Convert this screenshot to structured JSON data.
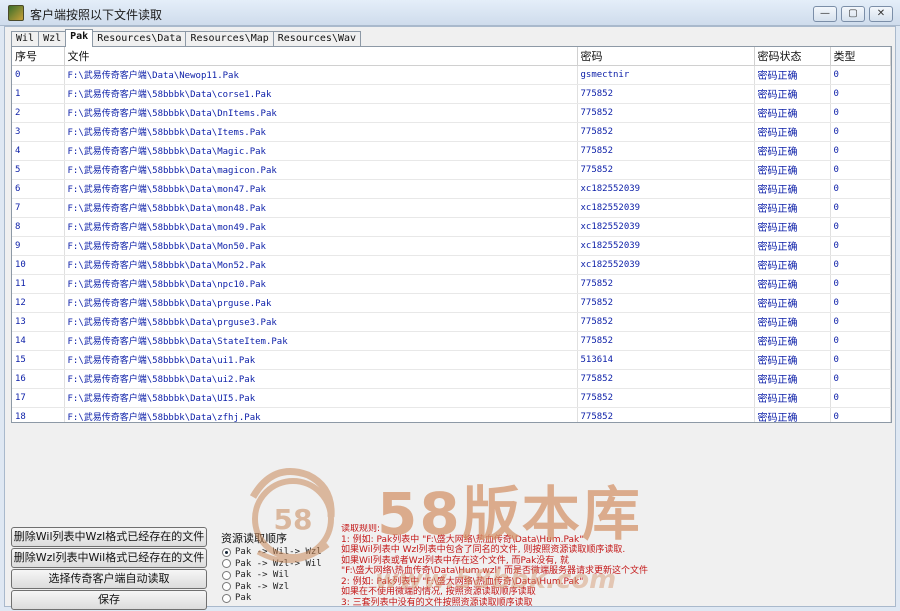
{
  "window": {
    "title": "客户端按照以下文件读取",
    "min": "—",
    "max": "▢",
    "close": "✕"
  },
  "tabs": [
    {
      "label": "Wil",
      "active": false
    },
    {
      "label": "Wzl",
      "active": false
    },
    {
      "label": "Pak",
      "active": true
    },
    {
      "label": "Resources\\Data",
      "active": false
    },
    {
      "label": "Resources\\Map",
      "active": false
    },
    {
      "label": "Resources\\Wav",
      "active": false
    }
  ],
  "table": {
    "headers": [
      "序号",
      "文件",
      "密码",
      "密码状态",
      "类型"
    ],
    "rows": [
      [
        "0",
        "F:\\武易传奇客户端\\Data\\Newop11.Pak",
        "gsmectnir",
        "密码正确",
        "0"
      ],
      [
        "1",
        "F:\\武易传奇客户端\\58bbbk\\Data\\corse1.Pak",
        "775852",
        "密码正确",
        "0"
      ],
      [
        "2",
        "F:\\武易传奇客户端\\58bbbk\\Data\\DnItems.Pak",
        "775852",
        "密码正确",
        "0"
      ],
      [
        "3",
        "F:\\武易传奇客户端\\58bbbk\\Data\\Items.Pak",
        "775852",
        "密码正确",
        "0"
      ],
      [
        "4",
        "F:\\武易传奇客户端\\58bbbk\\Data\\Magic.Pak",
        "775852",
        "密码正确",
        "0"
      ],
      [
        "5",
        "F:\\武易传奇客户端\\58bbbk\\Data\\magicon.Pak",
        "775852",
        "密码正确",
        "0"
      ],
      [
        "6",
        "F:\\武易传奇客户端\\58bbbk\\Data\\mon47.Pak",
        "xc182552039",
        "密码正确",
        "0"
      ],
      [
        "7",
        "F:\\武易传奇客户端\\58bbbk\\Data\\mon48.Pak",
        "xc182552039",
        "密码正确",
        "0"
      ],
      [
        "8",
        "F:\\武易传奇客户端\\58bbbk\\Data\\mon49.Pak",
        "xc182552039",
        "密码正确",
        "0"
      ],
      [
        "9",
        "F:\\武易传奇客户端\\58bbbk\\Data\\Mon50.Pak",
        "xc182552039",
        "密码正确",
        "0"
      ],
      [
        "10",
        "F:\\武易传奇客户端\\58bbbk\\Data\\Mon52.Pak",
        "xc182552039",
        "密码正确",
        "0"
      ],
      [
        "11",
        "F:\\武易传奇客户端\\58bbbk\\Data\\npc10.Pak",
        "775852",
        "密码正确",
        "0"
      ],
      [
        "12",
        "F:\\武易传奇客户端\\58bbbk\\Data\\prguse.Pak",
        "775852",
        "密码正确",
        "0"
      ],
      [
        "13",
        "F:\\武易传奇客户端\\58bbbk\\Data\\prguse3.Pak",
        "775852",
        "密码正确",
        "0"
      ],
      [
        "14",
        "F:\\武易传奇客户端\\58bbbk\\Data\\StateItem.Pak",
        "775852",
        "密码正确",
        "0"
      ],
      [
        "15",
        "F:\\武易传奇客户端\\58bbbk\\Data\\ui1.Pak",
        "513614",
        "密码正确",
        "0"
      ],
      [
        "16",
        "F:\\武易传奇客户端\\58bbbk\\Data\\ui2.Pak",
        "775852",
        "密码正确",
        "0"
      ],
      [
        "17",
        "F:\\武易传奇客户端\\58bbbk\\Data\\UI5.Pak",
        "775852",
        "密码正确",
        "0"
      ],
      [
        "18",
        "F:\\武易传奇客户端\\58bbbk\\Data\\zfhj.Pak",
        "775852",
        "密码正确",
        "0"
      ]
    ]
  },
  "buttons": {
    "delete_wil": "删除Wil列表中Wzl格式已经存在的文件",
    "delete_wzl": "删除Wzl列表中Wil格式已经存在的文件",
    "auto_read": "选择传奇客户端自动读取",
    "save": "保存"
  },
  "read_order": {
    "title": "资源读取顺序",
    "options": [
      {
        "label": "Pak -> Wil-> Wzl",
        "selected": true
      },
      {
        "label": "Pak -> Wzl-> Wil",
        "selected": false
      },
      {
        "label": "Pak -> Wil",
        "selected": false
      },
      {
        "label": "Pak -> Wzl",
        "selected": false
      },
      {
        "label": "Pak",
        "selected": false
      }
    ]
  },
  "rules": {
    "lines": [
      "读取规则:",
      "1: 例如: Pak列表中 \"F:\\盛大网络\\热血传奇\\Data\\Hum.Pak\"",
      "   如果Wil列表中 Wzl列表中包含了同名的文件, 则按照资源读取顺序读取.",
      "   如果Wil列表或者Wzl列表中存在这个文件, 而Pak没有, 就",
      "   \"F:\\盛大网络\\热血传奇\\Data\\Hum.wzl\" 而是否微端服务器请求更新这个文件",
      "2: 例如: Pak列表中 \"F:\\盛大网络\\热血传奇\\Data\\Hum.Pak\"",
      "   如果在不使用微端的情况, 按照资源读取顺序读取",
      "3: 三套列表中没有的文件按照资源读取顺序读取"
    ]
  },
  "watermark": {
    "text": "58版本库",
    "emblem": "58",
    "url": "www.58bbk.com"
  },
  "colors": {
    "cell_text": "#0b1ea8",
    "rules_text": "#c41818",
    "watermark": "#d4956b"
  }
}
